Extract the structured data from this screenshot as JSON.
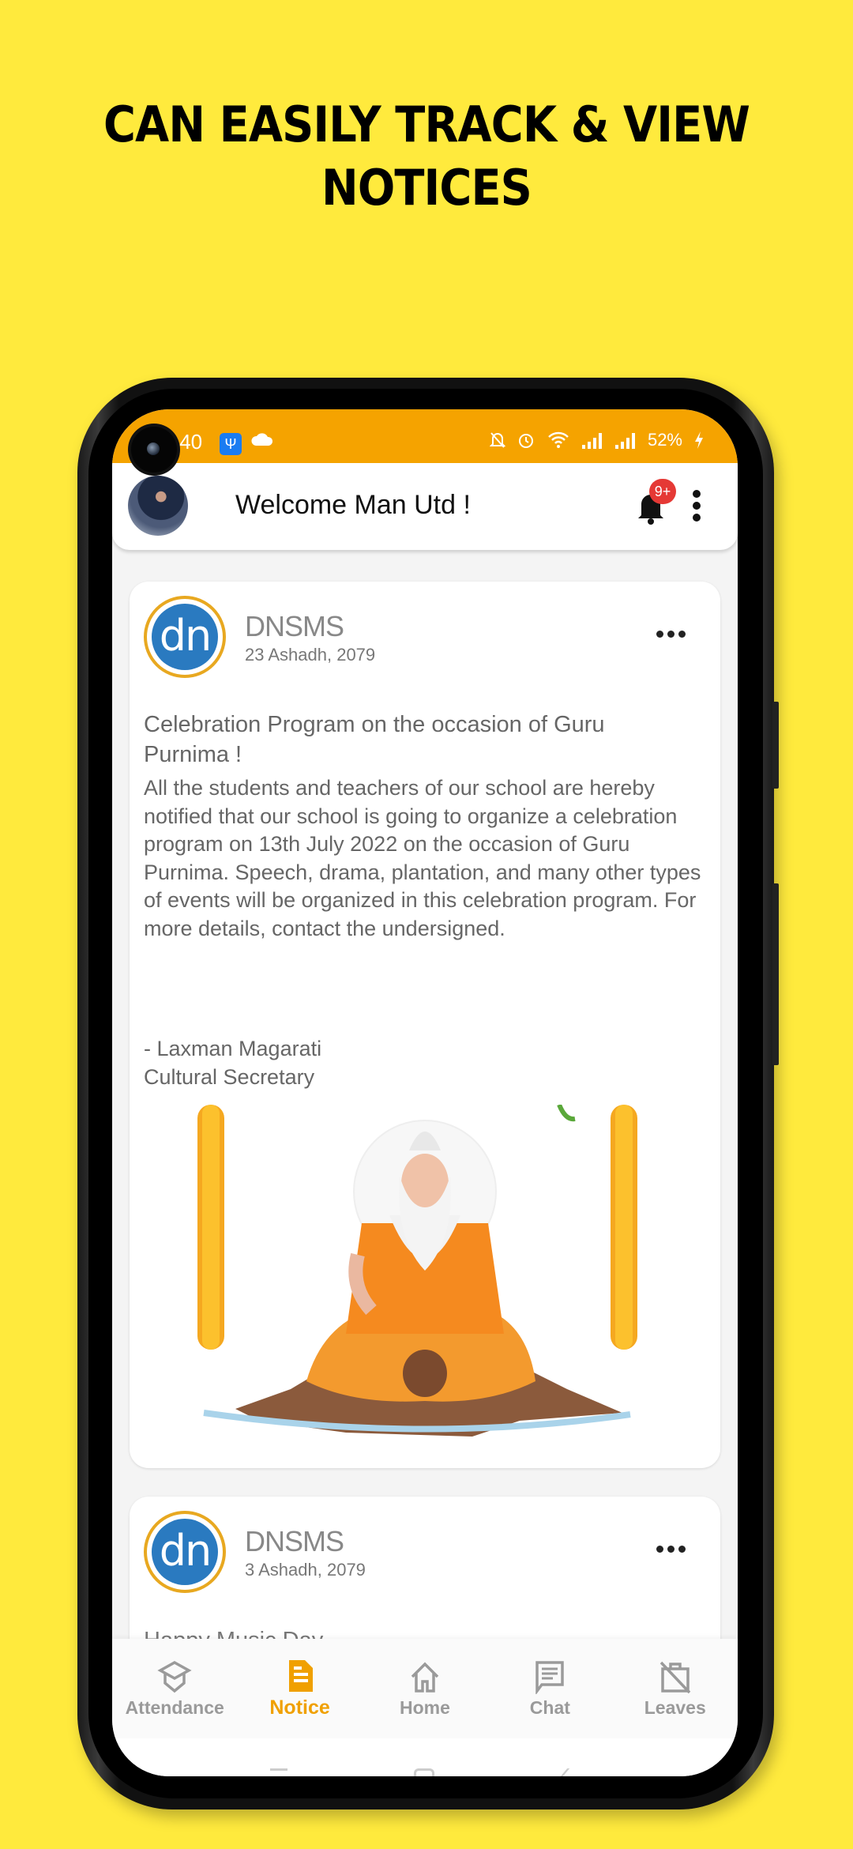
{
  "headline": {
    "line1": "CAN EASILY TRACK & VIEW",
    "line2": "NOTICES"
  },
  "status_bar": {
    "time": ":40",
    "battery": "52%",
    "icons": [
      "usb-icon",
      "cloud-icon",
      "mute-icon",
      "alarm-icon",
      "wifi-icon",
      "signal-icon",
      "signal-icon",
      "charging-icon"
    ]
  },
  "app_bar": {
    "welcome_text": "Welcome Man Utd !",
    "notification_badge": "9+"
  },
  "notices": [
    {
      "org": "DNSMS",
      "logo_text": "dn",
      "date": "23 Ashadh, 2079",
      "title": "Celebration Program on the occasion of Guru Purnima !",
      "body": "All the students and teachers of our school are hereby notified that our school is going to organize a celebration program on 13th July 2022 on the occasion of Guru Purnima. Speech, drama, plantation, and many other types of events will be organized in this celebration program. For more details, contact the undersigned.",
      "signature_name": "- Laxman Magarati",
      "signature_role": "Cultural Secretary",
      "image_alt": "Guru Purnima illustration of seated sage"
    },
    {
      "org": "DNSMS",
      "logo_text": "dn",
      "date": "3 Ashadh, 2079",
      "title": "Happy Music Day"
    }
  ],
  "bottom_nav": {
    "items": [
      {
        "label": "Attendance",
        "icon": "graduation-cap-icon",
        "active": false
      },
      {
        "label": "Notice",
        "icon": "document-icon",
        "active": true
      },
      {
        "label": "Home",
        "icon": "home-icon",
        "active": false
      },
      {
        "label": "Chat",
        "icon": "chat-icon",
        "active": false
      },
      {
        "label": "Leaves",
        "icon": "leave-off-icon",
        "active": false
      }
    ]
  },
  "colors": {
    "background": "#ffea3d",
    "status_bar": "#f5a300",
    "accent": "#f0a000",
    "badge": "#e53935",
    "logo_blue": "#2a7ac0",
    "logo_ring": "#e8a820"
  }
}
